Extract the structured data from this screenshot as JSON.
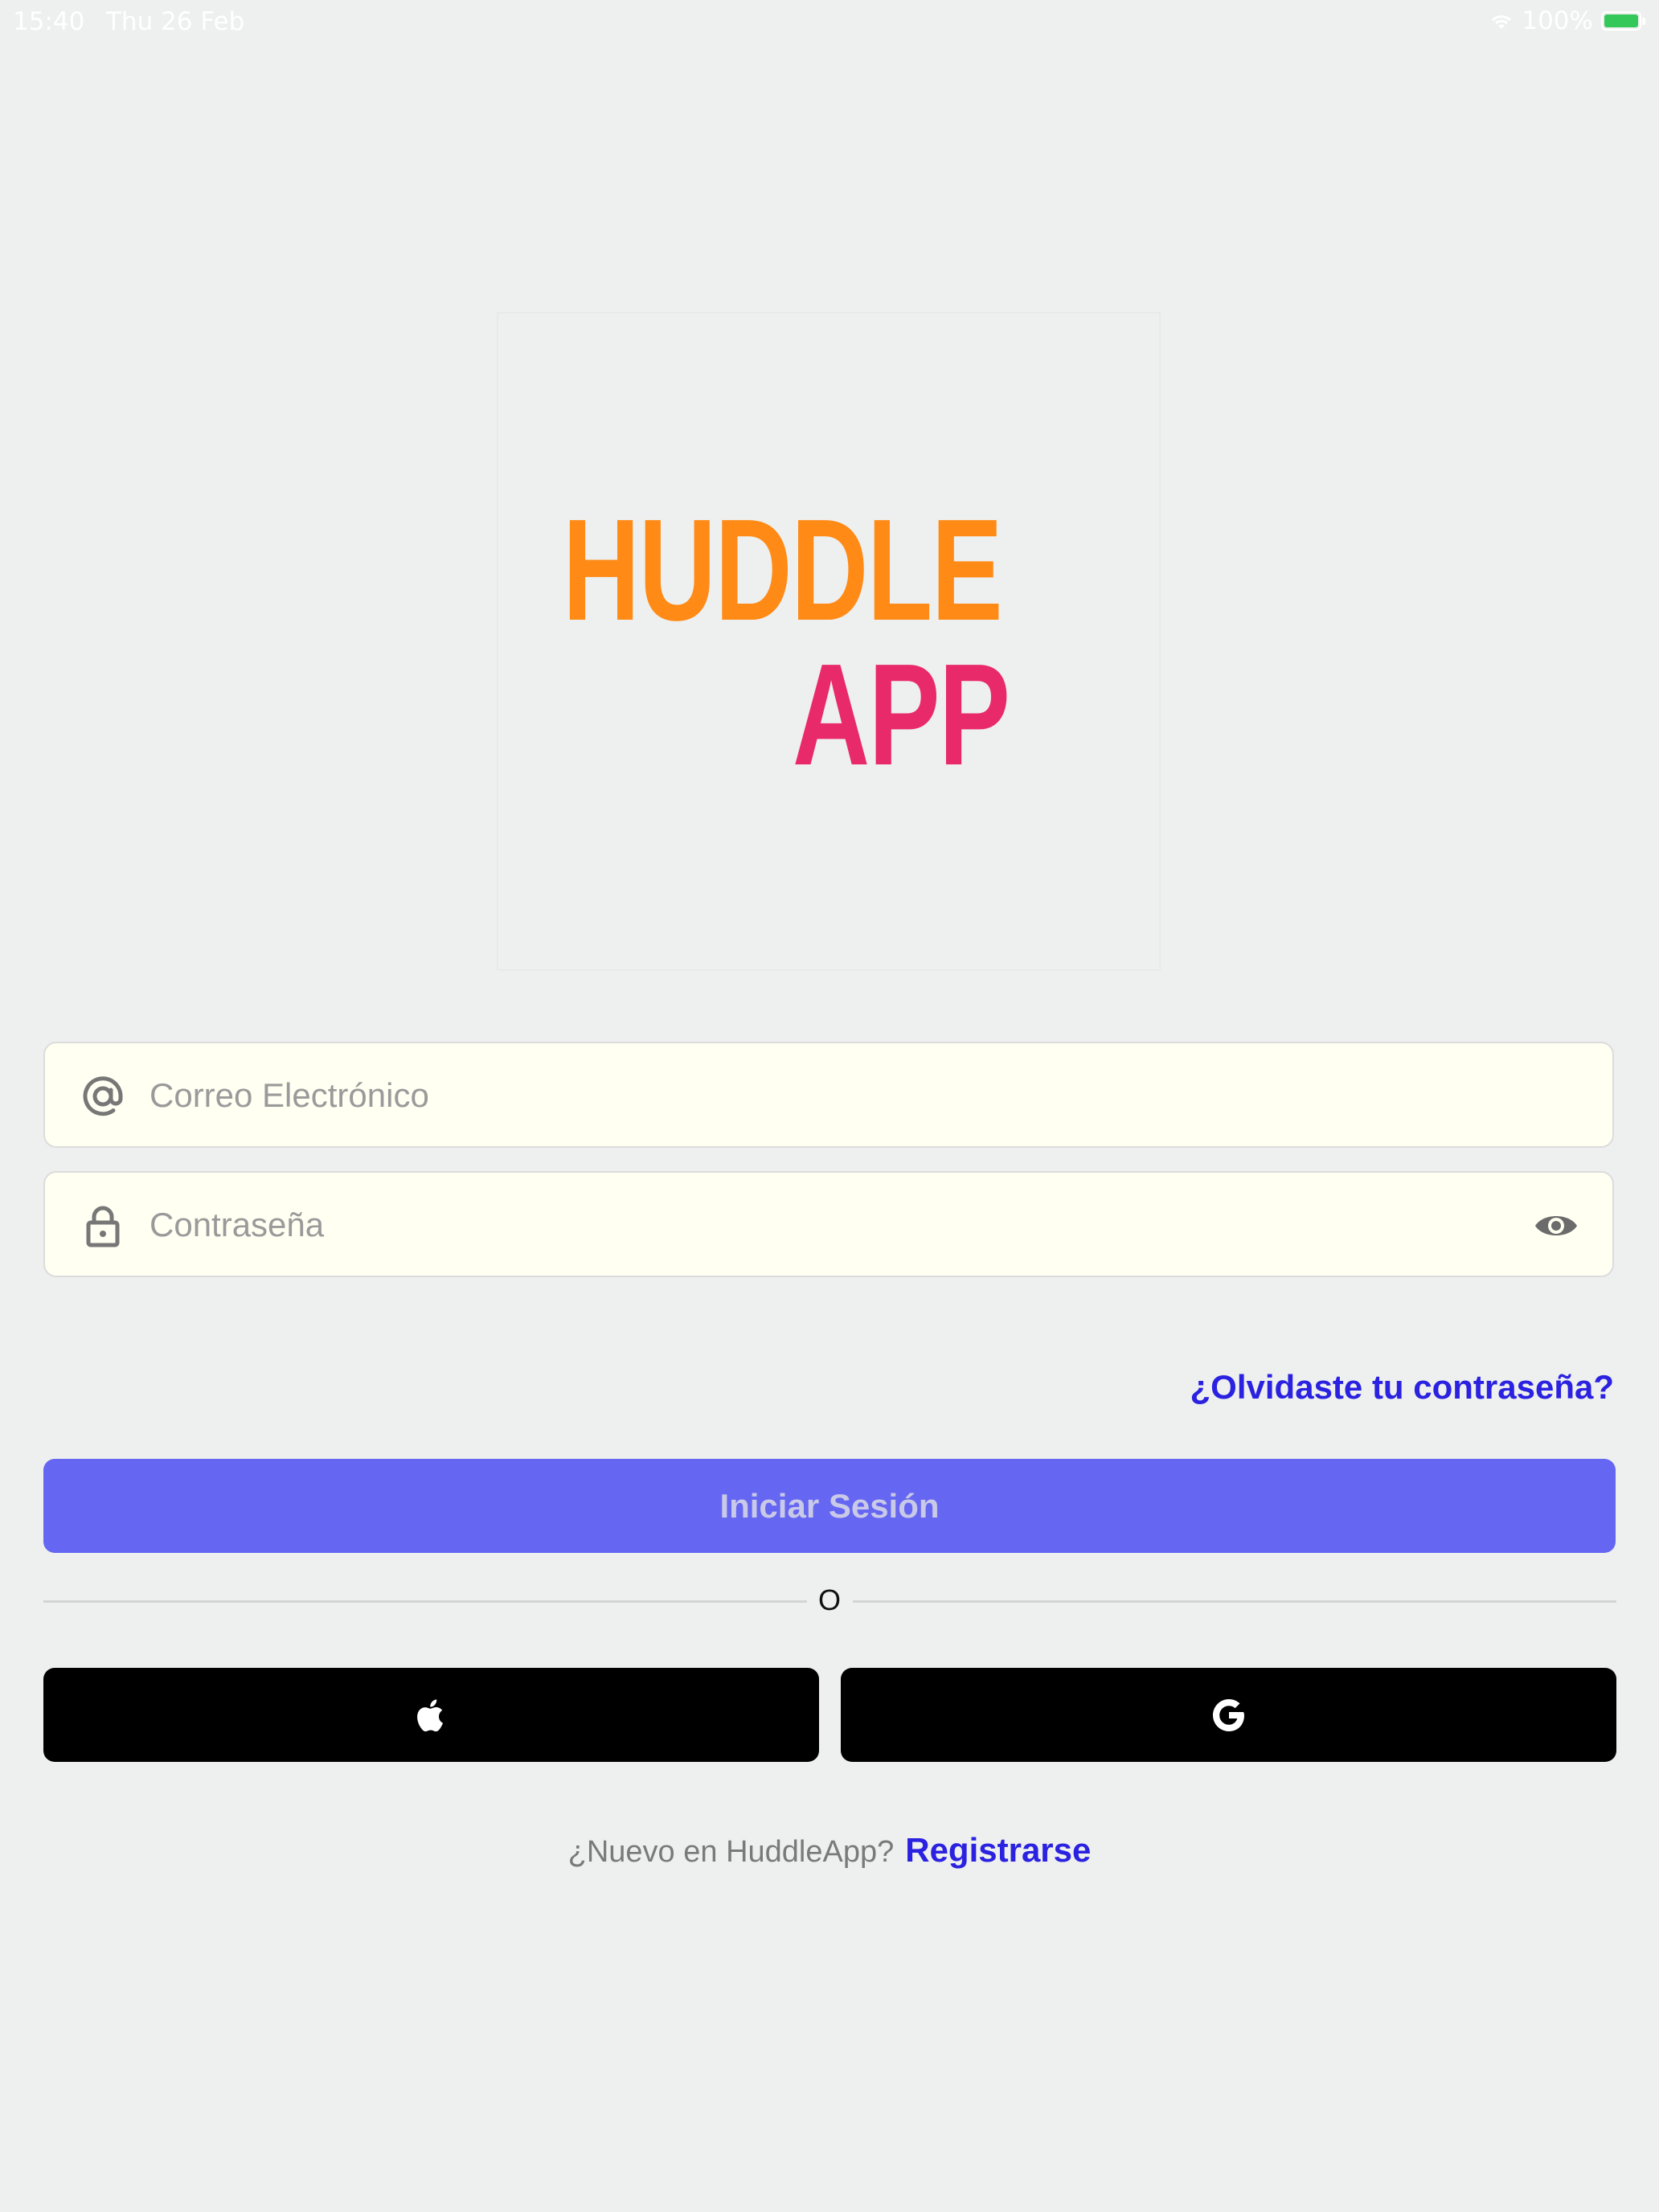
{
  "status_bar": {
    "time": "15:40",
    "date": "Thu 26 Feb",
    "battery": "100%",
    "icons": [
      "wifi-icon",
      "battery-icon"
    ]
  },
  "logo": {
    "line1": "HUDDLE",
    "line2": "APP",
    "line1_color": "#ff8a16",
    "line2_color": "#e82a6b"
  },
  "form": {
    "email": {
      "placeholder": "Correo Electrónico",
      "value": "",
      "icon": "at-icon"
    },
    "password": {
      "placeholder": "Contraseña",
      "value": "",
      "icon": "lock-icon",
      "toggle_icon": "eye-icon"
    },
    "forgot_label": "¿Olvidaste tu contraseña?",
    "login_label": "Iniciar Sesión",
    "divider_label": "O",
    "social": [
      {
        "name": "apple",
        "icon": "apple-icon"
      },
      {
        "name": "google",
        "icon": "google-icon"
      }
    ]
  },
  "register": {
    "prompt": "¿Nuevo en HuddleApp?",
    "link": "Registrarse"
  },
  "colors": {
    "background": "#eeefef",
    "primary": "#6566f1",
    "link": "#2a22e0",
    "input_bg": "#fffff2"
  }
}
